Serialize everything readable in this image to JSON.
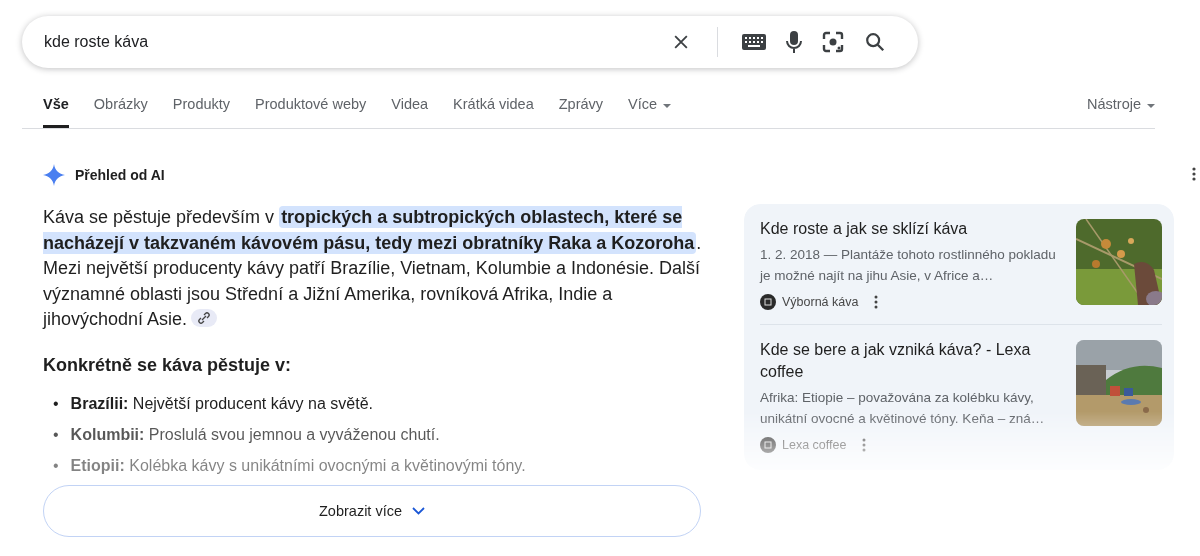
{
  "search": {
    "value": "kde roste káva"
  },
  "tabs": [
    {
      "label": "Vše",
      "selected": true,
      "dropdown": false
    },
    {
      "label": "Obrázky",
      "selected": false,
      "dropdown": false
    },
    {
      "label": "Produkty",
      "selected": false,
      "dropdown": false
    },
    {
      "label": "Produktové weby",
      "selected": false,
      "dropdown": false
    },
    {
      "label": "Videa",
      "selected": false,
      "dropdown": false
    },
    {
      "label": "Krátká videa",
      "selected": false,
      "dropdown": false
    },
    {
      "label": "Zprávy",
      "selected": false,
      "dropdown": false
    },
    {
      "label": "Více",
      "selected": false,
      "dropdown": true
    }
  ],
  "tools": {
    "label": "Nástroje"
  },
  "ai_overview": {
    "title": "Přehled od AI",
    "paragraph": [
      {
        "text": "Káva se pěstuje především v ",
        "highlighted": false
      },
      {
        "text": "tropických a subtropických oblastech, které se nacházejí v takzvaném kávovém pásu, tedy mezi obratníky Raka a Kozoroha",
        "highlighted": true
      },
      {
        "text": ". Mezi největší producenty kávy patří Brazílie, Vietnam, Kolumbie a Indonésie. Další významné oblasti jsou Střední a Jižní Amerika, rovníková Afrika, Indie a jihovýchodní Asie.",
        "highlighted": false
      }
    ],
    "heading": "Konkrétně se káva pěstuje v:",
    "bullets": [
      {
        "marker": "•",
        "text": "**Brazílii:** Největší producent kávy na světě."
      },
      {
        "marker": "•",
        "text": "**Kolumbii:** Proslulá svou jemnou a vyváženou chutí."
      },
      {
        "marker": "•",
        "text": "**Etiopii:** Kolébka kávy s unikátními ovocnými a květinovými tóny."
      }
    ],
    "show_more": "Zobrazit více"
  },
  "sources": [
    {
      "title": "Kde roste a jak se sklízí káva",
      "snippet": "1. 2. 2018 — Plantáže tohoto rostlinného pokladu je možné najít na jihu Asie, v Africe a…",
      "site": "Výborná káva"
    },
    {
      "title": "Kde se bere a jak vzniká káva? - Lexa coffee",
      "snippet": "Afrika: Etiopie – považována za kolébku kávy, unikátní ovocné a květinové tóny. Keňa – zná…",
      "site": "Lexa coffee"
    }
  ]
}
